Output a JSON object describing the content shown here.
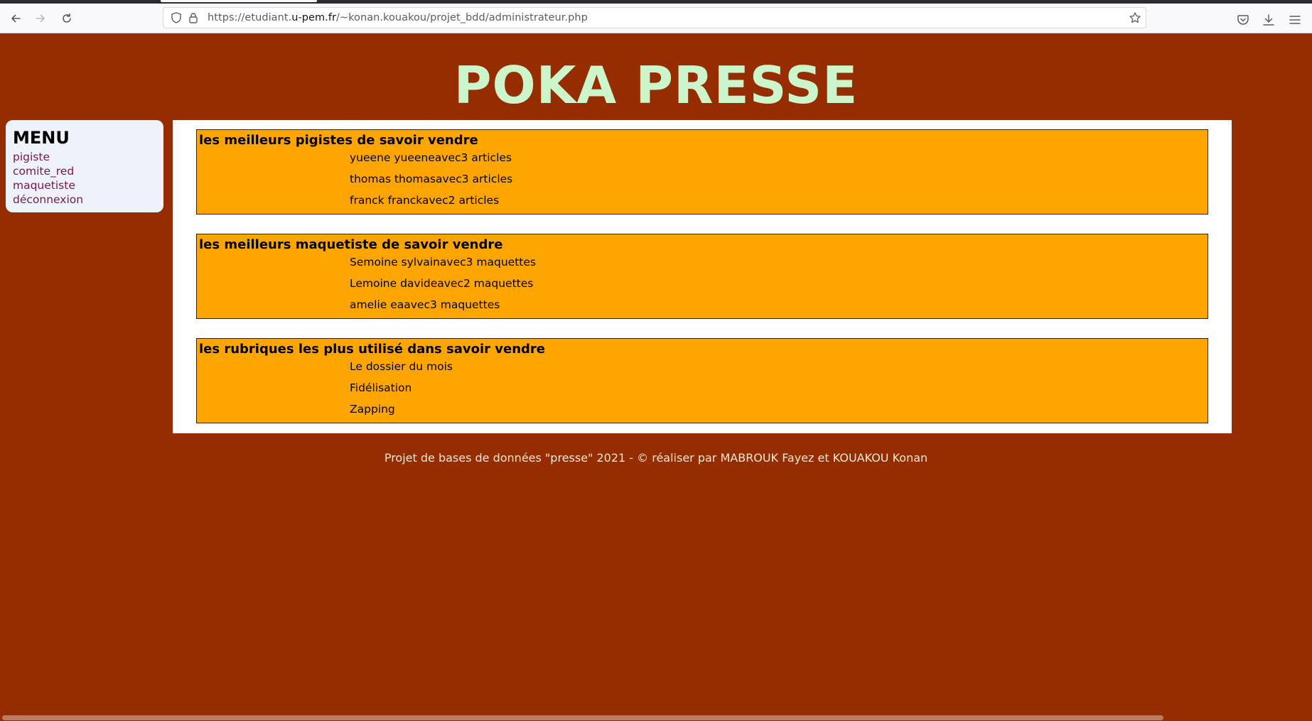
{
  "browser": {
    "url_prefix": "https://etudiant.",
    "url_domain": "u-pem.fr",
    "url_path": "/~konan.kouakou/projet_bdd/administrateur.php"
  },
  "site": {
    "title": "POKA PRESSE"
  },
  "menu": {
    "heading": "MENU",
    "links": [
      "pigiste",
      "comite_red",
      "maquetiste",
      "déconnexion"
    ]
  },
  "sections": [
    {
      "heading": "les meilleurs pigistes de savoir vendre",
      "items": [
        "yueene yueeneavec3 articles",
        "thomas thomasavec3 articles",
        "franck franckavec2 articles"
      ]
    },
    {
      "heading": "les meilleurs maquetiste de savoir vendre",
      "items": [
        "Semoine sylvainavec3 maquettes",
        "Lemoine davideavec2 maquettes",
        "amelie eaavec3 maquettes"
      ]
    },
    {
      "heading": "les rubriques les plus utilisé dans savoir vendre",
      "items": [
        "Le dossier du mois",
        "Fidélisation",
        "Zapping"
      ]
    }
  ],
  "footer": {
    "text": "Projet de bases de données \"presse\" 2021 - © réaliser par MABROUK Fayez et KOUAKOU Konan"
  },
  "colors": {
    "page_background": "#952d00",
    "title": "#ccf5cc",
    "section_background": "#ffa500",
    "menu_background": "#eef3fb",
    "menu_link": "#7a1450"
  },
  "icons": {
    "back": "arrow-left-icon",
    "forward": "arrow-right-icon",
    "reload": "reload-icon",
    "tracking": "shield-icon",
    "secure": "lock-icon",
    "bookmark": "star-icon",
    "pocket": "pocket-icon",
    "downloads": "download-icon",
    "menu": "hamburger-menu-icon"
  }
}
